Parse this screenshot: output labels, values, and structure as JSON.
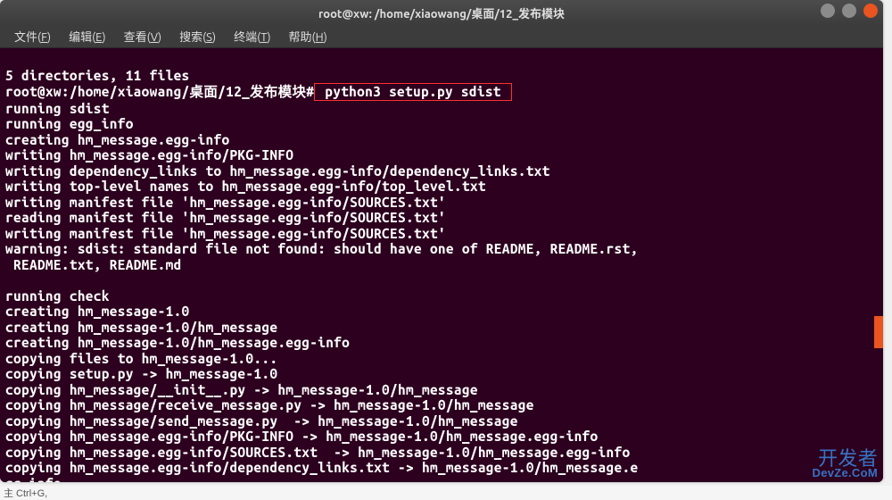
{
  "titlebar": {
    "title": "root@xw: /home/xiaowang/桌面/12_发布模块"
  },
  "menubar": {
    "file": {
      "label": "文件(F)"
    },
    "edit": {
      "label": "编辑(E)"
    },
    "view": {
      "label": "查看(V)"
    },
    "search": {
      "label": "搜索(S)"
    },
    "terminal": {
      "label": "终端(T)"
    },
    "help": {
      "label": "帮助(H)"
    }
  },
  "terminal": {
    "line_summary": "5 directories, 11 files",
    "prompt": "root@xw:/home/xiaowang/桌面/12_发布模块#",
    "command": " python3 setup.py sdist ",
    "output": [
      "running sdist",
      "running egg_info",
      "creating hm_message.egg-info",
      "writing hm_message.egg-info/PKG-INFO",
      "writing dependency_links to hm_message.egg-info/dependency_links.txt",
      "writing top-level names to hm_message.egg-info/top_level.txt",
      "writing manifest file 'hm_message.egg-info/SOURCES.txt'",
      "reading manifest file 'hm_message.egg-info/SOURCES.txt'",
      "writing manifest file 'hm_message.egg-info/SOURCES.txt'",
      "warning: sdist: standard file not found: should have one of README, README.rst,",
      " README.txt, README.md",
      "",
      "running check",
      "creating hm_message-1.0",
      "creating hm_message-1.0/hm_message",
      "creating hm_message-1.0/hm_message.egg-info",
      "copying files to hm_message-1.0...",
      "copying setup.py -> hm_message-1.0",
      "copying hm_message/__init__.py -> hm_message-1.0/hm_message",
      "copying hm_message/receive_message.py -> hm_message-1.0/hm_message",
      "copying hm_message/send_message.py  -> hm_message-1.0/hm_message",
      "copying hm_message.egg-info/PKG-INFO -> hm_message-1.0/hm_message.egg-info",
      "copying hm_message.egg-info/SOURCES.txt  -> hm_message-1.0/hm_message.egg-info",
      "copying hm_message.egg-info/dependency_links.txt -> hm_message-1.0/hm_message.e",
      "gg-info"
    ]
  },
  "watermark": {
    "main": "开发者",
    "sub": "DevZe.CoM"
  },
  "statusbar": {
    "text": "主 Ctrl+G,"
  }
}
